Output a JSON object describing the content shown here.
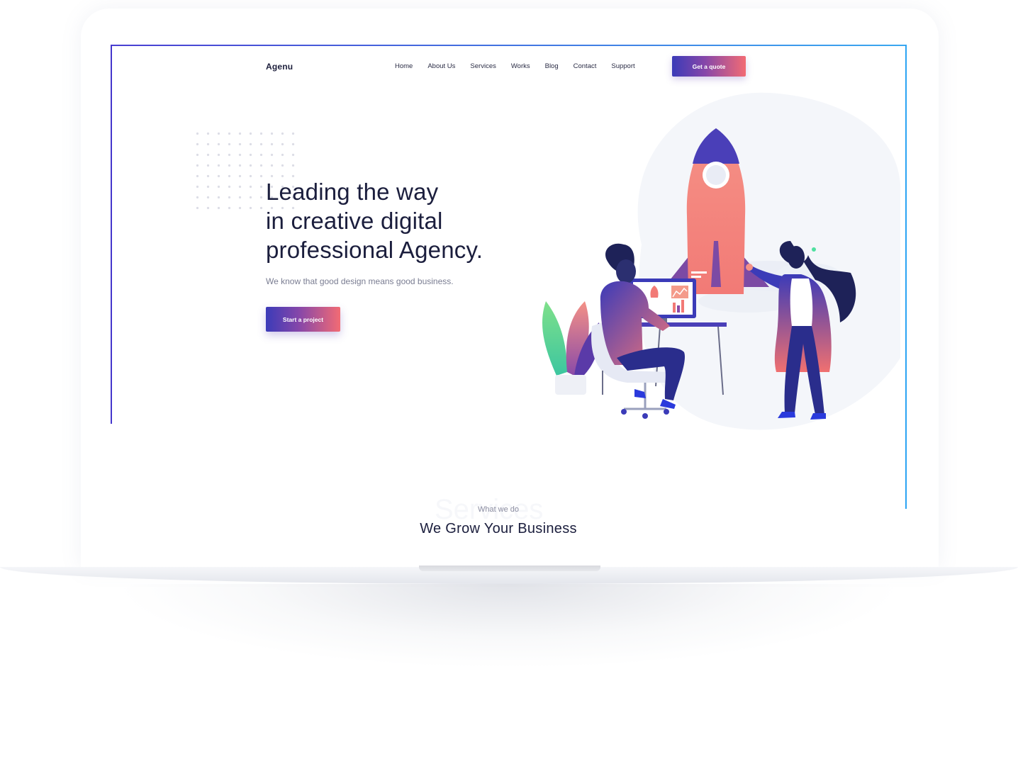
{
  "header": {
    "brand": "Agenu",
    "nav": [
      "Home",
      "About Us",
      "Services",
      "Works",
      "Blog",
      "Contact",
      "Support"
    ],
    "cta": "Get a quote"
  },
  "hero": {
    "title_lines": [
      "Leading the way",
      "in creative digital",
      "professional Agency."
    ],
    "subtitle": "We know that good design means good business.",
    "cta": "Start a project"
  },
  "services": {
    "ghost": "Services",
    "eyebrow": "What we do",
    "title": "We Grow Your Business"
  },
  "colors": {
    "gradient_start": "#3b3bb8",
    "gradient_end": "#f26b74",
    "heading": "#1b1e3d",
    "border_left": "#4436cc",
    "border_right": "#2aa3f3"
  }
}
